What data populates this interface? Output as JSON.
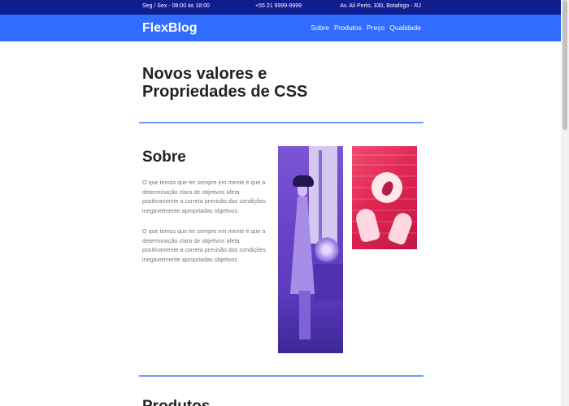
{
  "topbar": {
    "hours": "Seg / Sex - 08:00 às 18:00",
    "phone": "+55 21 9999-9999",
    "address": "Av. Ali Perto, 330, Botafogo - RJ"
  },
  "navbar": {
    "logo": "FlexBlog",
    "items": [
      {
        "label": "Sobre"
      },
      {
        "label": "Produtos"
      },
      {
        "label": "Preço"
      },
      {
        "label": "Qualidade"
      }
    ]
  },
  "hero": {
    "title": "Novos valores e Propriedades de CSS"
  },
  "about": {
    "title": "Sobre",
    "paragraphs": [
      "O que temos que ter sempre em mente é que a determinação clara de objetivos afeta positivamente a correta previsão das condições inegavelmente apropriadas objetivos.",
      "O que temos que ter sempre em mente é que a determinação clara de objetivos afeta positivamente a correta previsão das condições inegavelmente apropriadas objetivos."
    ]
  },
  "next_section": {
    "title": "Produtos"
  },
  "colors": {
    "topbar": "#0f1d8f",
    "navbar": "#2f6cff",
    "divider": "#6f9bff",
    "image1": "#6a43c8",
    "image2": "#de2350"
  }
}
